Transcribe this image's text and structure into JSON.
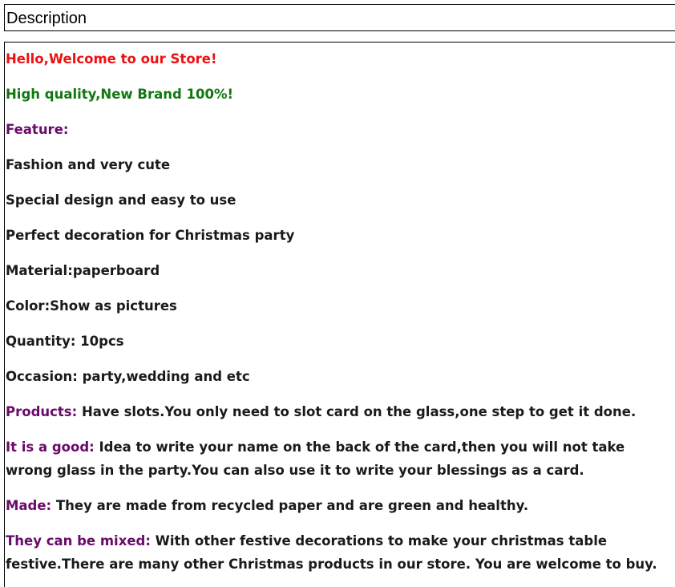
{
  "header": {
    "title": "Description"
  },
  "content": {
    "welcome": "Hello,Welcome to our Store!",
    "quality": "High quality,New Brand 100%!",
    "feature_heading": "Feature:",
    "features": [
      "Fashion and very cute",
      "Special design and easy to use",
      "Perfect decoration for Christmas party",
      "Material:paperboard",
      "Color:Show as pictures",
      "Quantity: 10pcs",
      "Occasion: party,wedding and etc"
    ],
    "products_label": "Products:",
    "products_text": " Have slots.You only need to slot card on the glass,one step to get it done.",
    "good_label": "It is a good:",
    "good_text": " Idea to write your name on the back of the card,then you will not take wrong glass in the party.You can also use it to write your blessings as a card.",
    "made_label": "Made:",
    "made_text": " They are made from recycled paper and are green and healthy.",
    "mixed_label": "They can be mixed:",
    "mixed_text": " With other festive decorations to make your christmas table festive.There are many other Christmas products in our store. You are welcome to buy."
  },
  "colors": {
    "welcome": "#ee1111",
    "quality": "#117711",
    "label": "#6a0a6a",
    "text": "#1a1a1a"
  }
}
